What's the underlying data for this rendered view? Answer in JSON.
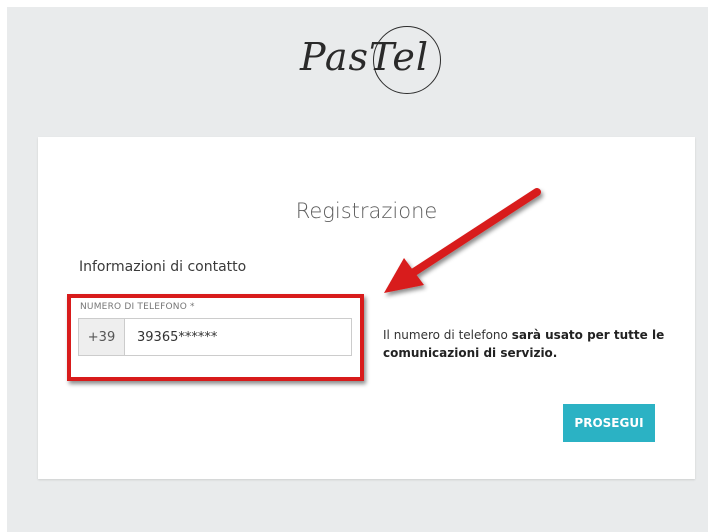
{
  "logo": {
    "text": "PasTel"
  },
  "card": {
    "title": "Registrazione",
    "section_title": "Informazioni di contatto",
    "phone_field": {
      "label": "NUMERO DI TELEFONO *",
      "prefix": "+39",
      "value": "39365******"
    },
    "helper": {
      "text_normal": "Il numero di telefono ",
      "text_bold": "sarà usato per tutte le comunicazioni di servizio."
    },
    "proceed_label": "PROSEGUI"
  },
  "annotation": {
    "color": "#d81b1b"
  },
  "colors": {
    "accent": "#2bb2c4",
    "background": "#e9ebec"
  }
}
